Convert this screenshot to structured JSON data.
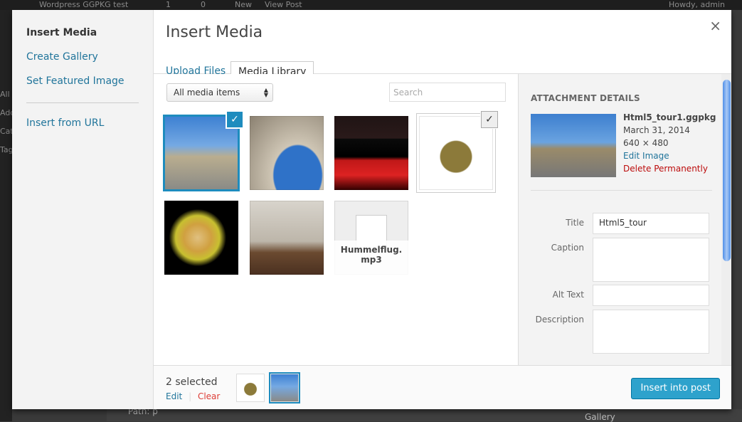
{
  "adminbar": {
    "site": "Wordpress GGPKG test",
    "updates": "1",
    "comments": "0",
    "new": "New",
    "view": "View Post",
    "howdy": "Howdy, admin"
  },
  "adminmenu": [
    "All",
    "Add",
    "Cat",
    "Tag"
  ],
  "background": {
    "path": "Path: p",
    "gallery": "Gallery"
  },
  "menu": {
    "items": [
      "Insert Media",
      "Create Gallery",
      "Set Featured Image",
      "Insert from URL"
    ]
  },
  "title": "Insert Media",
  "close": "×",
  "tabs": [
    "Upload Files",
    "Media Library"
  ],
  "filter": {
    "selected": "All media items",
    "search_placeholder": "Search"
  },
  "grid": [
    {
      "kind": "panorama",
      "selected": true,
      "focused": true
    },
    {
      "kind": "arch",
      "selected": false
    },
    {
      "kind": "theater",
      "selected": false
    },
    {
      "kind": "reindeer",
      "selected": true,
      "focused": false
    },
    {
      "kind": "head3d",
      "selected": false
    },
    {
      "kind": "room",
      "selected": false
    },
    {
      "kind": "audio",
      "selected": false,
      "name": "Hummelflug.mp3"
    }
  ],
  "details": {
    "heading": "ATTACHMENT DETAILS",
    "filename": "Html5_tour1.ggpkg",
    "date": "March 31, 2014",
    "dimensions": "640 × 480",
    "edit": "Edit Image",
    "delete": "Delete Permanently",
    "fields": [
      {
        "label": "Title",
        "value": "Html5_tour"
      },
      {
        "label": "Caption",
        "value": ""
      },
      {
        "label": "Alt Text",
        "value": ""
      },
      {
        "label": "Description",
        "value": ""
      }
    ]
  },
  "toolbar": {
    "count": "2 selected",
    "edit": "Edit",
    "clear": "Clear",
    "insert": "Insert into post"
  },
  "colors": {
    "accent": "#1e8cbe",
    "link": "#21759b",
    "danger": "#dd3d36",
    "button": "#2ea2cc"
  }
}
